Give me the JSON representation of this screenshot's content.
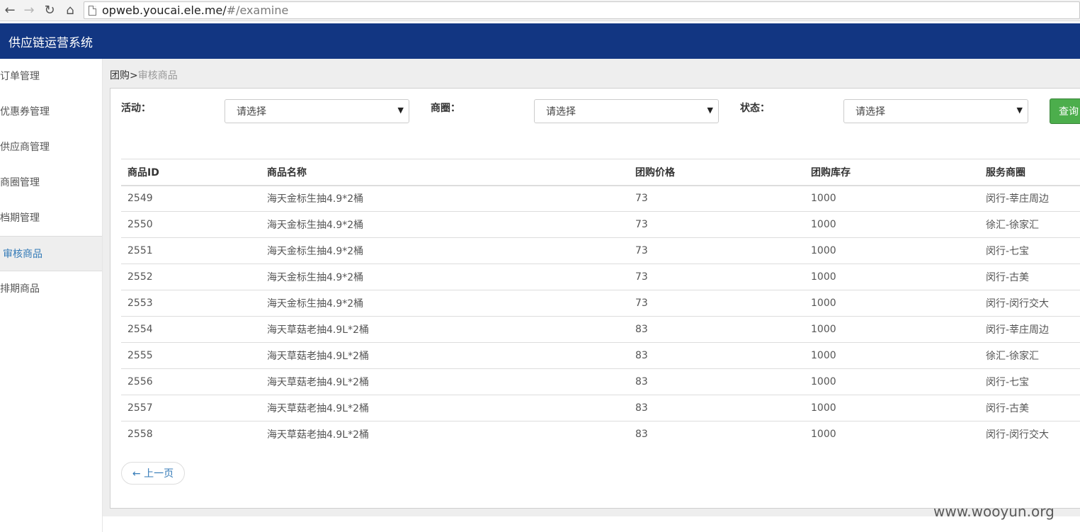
{
  "browser": {
    "url_host": "opweb.youcai.ele.me/",
    "url_path": "#/examine"
  },
  "app": {
    "title": "供应链运营系统"
  },
  "sidebar": {
    "items": [
      {
        "label": "订单管理"
      },
      {
        "label": "优惠券管理"
      },
      {
        "label": "供应商管理"
      },
      {
        "label": "商圈管理"
      },
      {
        "label": "档期管理"
      },
      {
        "label": "审核商品"
      },
      {
        "label": "排期商品"
      }
    ],
    "active_index": 5
  },
  "breadcrumb": {
    "parent": "团购",
    "separator": ">",
    "current": "审核商品"
  },
  "filters": {
    "activity_label": "活动：",
    "activity_value": "请选择",
    "district_label": "商圈：",
    "district_value": "请选择",
    "status_label": "状态：",
    "status_value": "请选择",
    "query_label": "查询"
  },
  "table": {
    "headers": [
      "商品ID",
      "商品名称",
      "团购价格",
      "团购库存",
      "服务商圈"
    ],
    "rows": [
      [
        "2549",
        "海天金标生抽4.9*2桶",
        "73",
        "1000",
        "闵行-莘庄周边"
      ],
      [
        "2550",
        "海天金标生抽4.9*2桶",
        "73",
        "1000",
        "徐汇-徐家汇"
      ],
      [
        "2551",
        "海天金标生抽4.9*2桶",
        "73",
        "1000",
        "闵行-七宝"
      ],
      [
        "2552",
        "海天金标生抽4.9*2桶",
        "73",
        "1000",
        "闵行-古美"
      ],
      [
        "2553",
        "海天金标生抽4.9*2桶",
        "73",
        "1000",
        "闵行-闵行交大"
      ],
      [
        "2554",
        "海天草菇老抽4.9L*2桶",
        "83",
        "1000",
        "闵行-莘庄周边"
      ],
      [
        "2555",
        "海天草菇老抽4.9L*2桶",
        "83",
        "1000",
        "徐汇-徐家汇"
      ],
      [
        "2556",
        "海天草菇老抽4.9L*2桶",
        "83",
        "1000",
        "闵行-七宝"
      ],
      [
        "2557",
        "海天草菇老抽4.9L*2桶",
        "83",
        "1000",
        "闵行-古美"
      ],
      [
        "2558",
        "海天草菇老抽4.9L*2桶",
        "83",
        "1000",
        "闵行-闵行交大"
      ]
    ]
  },
  "pagination": {
    "prev_label": "← 上一页"
  },
  "watermark": "www.wooyun.org",
  "colors": {
    "header_bg": "#123682",
    "query_button": "#4cae4c",
    "link": "#337ab7"
  }
}
